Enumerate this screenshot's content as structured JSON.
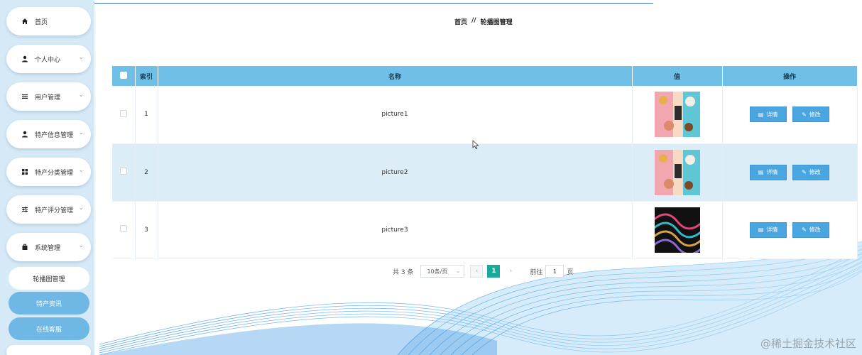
{
  "breadcrumb": {
    "home": "首页",
    "separator": "//",
    "current": "轮播图管理"
  },
  "sidebar": {
    "items": [
      {
        "icon": "home-icon",
        "label": "首页",
        "has_arrow": false
      },
      {
        "icon": "user-icon",
        "label": "个人中心",
        "has_arrow": true
      },
      {
        "icon": "list-icon",
        "label": "用户管理",
        "has_arrow": true
      },
      {
        "icon": "user-icon",
        "label": "特产信息管理",
        "has_arrow": true
      },
      {
        "icon": "grid-icon",
        "label": "特产分类管理",
        "has_arrow": true
      },
      {
        "icon": "sliders-icon",
        "label": "特产评分管理",
        "has_arrow": true
      },
      {
        "icon": "briefcase-icon",
        "label": "系统管理",
        "has_arrow": true
      }
    ],
    "sub_items": [
      {
        "label": "轮播图管理"
      },
      {
        "label": "特产资讯"
      },
      {
        "label": "在线客服"
      }
    ]
  },
  "table": {
    "headers": {
      "index": "索引",
      "name": "名称",
      "value": "值",
      "actions": "操作"
    },
    "rows": [
      {
        "index": "1",
        "name": "picture1",
        "thumb": "pastry-collage"
      },
      {
        "index": "2",
        "name": "picture2",
        "thumb": "pastry-collage"
      },
      {
        "index": "3",
        "name": "picture3",
        "thumb": "dark-wave-pattern"
      }
    ],
    "detail_label": "详情",
    "edit_label": "修改"
  },
  "pagination": {
    "total": "共 3 条",
    "page_size": "10条/页",
    "prev": "‹",
    "current_page": "1",
    "next": "›",
    "goto_prefix": "前往",
    "goto_value": "1",
    "goto_suffix": "页"
  },
  "watermark": "@稀土掘金技术社区",
  "colors": {
    "sidebar_bg": "#d6e9f6",
    "header_bg": "#6fbfe6",
    "button_bg": "#4aa6e0",
    "active_page": "#1aa89a"
  }
}
